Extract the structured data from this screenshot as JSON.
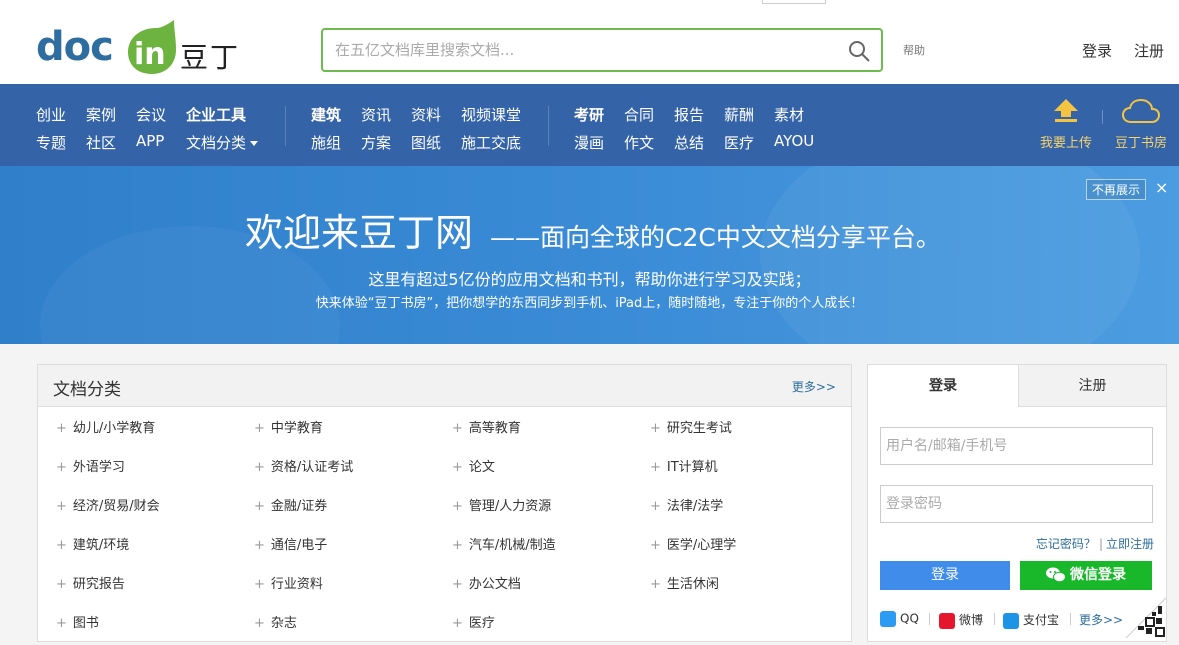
{
  "header": {
    "logo_text": "doc",
    "logo_badge": "in",
    "logo_cn": "豆丁",
    "search_placeholder": "在五亿文档库里搜索文档...",
    "help": "帮助",
    "login": "登录",
    "register": "注册"
  },
  "nav": {
    "group1_row1": [
      "创业",
      "案例",
      "会议",
      "企业工具"
    ],
    "group1_row2": [
      "专题",
      "社区",
      "APP",
      "文档分类"
    ],
    "group2_row1": [
      "建筑",
      "资讯",
      "资料",
      "视频课堂"
    ],
    "group2_row2": [
      "施组",
      "方案",
      "图纸",
      "施工交底"
    ],
    "group3_row1": [
      "考研",
      "合同",
      "报告",
      "薪酬",
      "素材"
    ],
    "group3_row2": [
      "漫画",
      "作文",
      "总结",
      "医疗",
      "AYOU"
    ],
    "upload": "我要上传",
    "bookshelf": "豆丁书房"
  },
  "banner": {
    "title": "欢迎来豆丁网",
    "subtitle": "——面向全球的C2C中文文档分享平台。",
    "line1": "这里有超过5亿份的应用文档和书刊，帮助你进行学习及实践；",
    "line2": "快来体验“豆丁书房”，把你想学的东西同步到手机、iPad上，随时随地，专注于你的个人成长！",
    "no_more": "不再展示",
    "close": "×"
  },
  "categories": {
    "title": "文档分类",
    "more": "更多>>",
    "items": [
      "幼儿/小学教育",
      "中学教育",
      "高等教育",
      "研究生考试",
      "外语学习",
      "资格/认证考试",
      "论文",
      "IT计算机",
      "经济/贸易/财会",
      "金融/证券",
      "管理/人力资源",
      "法律/法学",
      "建筑/环境",
      "通信/电子",
      "汽车/机械/制造",
      "医学/心理学",
      "研究报告",
      "行业资料",
      "办公文档",
      "生活休闲",
      "图书",
      "杂志",
      "医疗"
    ]
  },
  "login_panel": {
    "tab_login": "登录",
    "tab_register": "注册",
    "username_placeholder": "用户名/邮箱/手机号",
    "password_placeholder": "登录密码",
    "forgot": "忘记密码？",
    "register_now": "立即注册",
    "login_button": "登录",
    "wechat_button": "微信登录",
    "social": [
      "QQ",
      "微博",
      "支付宝",
      "更多>>"
    ]
  },
  "colors": {
    "nav_bg": "#3463a8",
    "search_border": "#6dbb4e",
    "login_button": "#3f8ceb",
    "wechat_button": "#19b82a",
    "nav_highlight": "#f5d46e"
  }
}
